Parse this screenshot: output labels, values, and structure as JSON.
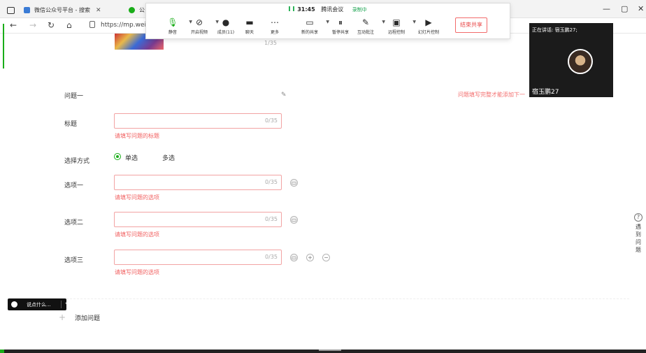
{
  "browser": {
    "tab1_title": "微信公众号平台 - 搜索",
    "tab2_title": "公",
    "url": "https://mp.weixin",
    "win_controls": [
      "—",
      "▢",
      "✕"
    ]
  },
  "meeting": {
    "time": "31:45",
    "app_name": "腾讯会议",
    "record_status": "录制中",
    "tools": [
      {
        "label": "静音",
        "icon": "microphone-icon"
      },
      {
        "label": "开启视频",
        "icon": "camera-off-icon"
      },
      {
        "label": "成员(11)",
        "icon": "members-icon"
      },
      {
        "label": "聊天",
        "icon": "chat-icon"
      },
      {
        "label": "更多",
        "icon": "more-icon"
      },
      {
        "label": "新的共享",
        "icon": "share-icon"
      },
      {
        "label": "暂停共享",
        "icon": "pause-icon"
      },
      {
        "label": "互动批注",
        "icon": "annotate-icon"
      },
      {
        "label": "远程控制",
        "icon": "remote-control-icon"
      },
      {
        "label": "幻灯片控制",
        "icon": "slide-control-icon"
      }
    ],
    "end_share_label": "结束共享",
    "speaking_label": "正在讲话: 宿玉鹏27;",
    "participant_name": "宿玉鹏27"
  },
  "form": {
    "top_counter": "1/35",
    "question_label": "问题一",
    "warning": "问题填写完整才能添加下一",
    "title_label": "标题",
    "title_counter": "0/35",
    "title_error": "请填写问题的标题",
    "choice_label": "选择方式",
    "single_label": "单选",
    "multi_label": "多选",
    "option_labels": [
      "选项一",
      "选项二",
      "选项三"
    ],
    "option_counter": "0/35",
    "option_error": "请填写问题的选项",
    "add_question": "添加问题"
  },
  "side_help": "遇到问题",
  "chat_pill_text": "说点什么...",
  "colors": {
    "accent": "#1aad19",
    "error": "#f15f5f",
    "end_share": "#e94b4b"
  }
}
